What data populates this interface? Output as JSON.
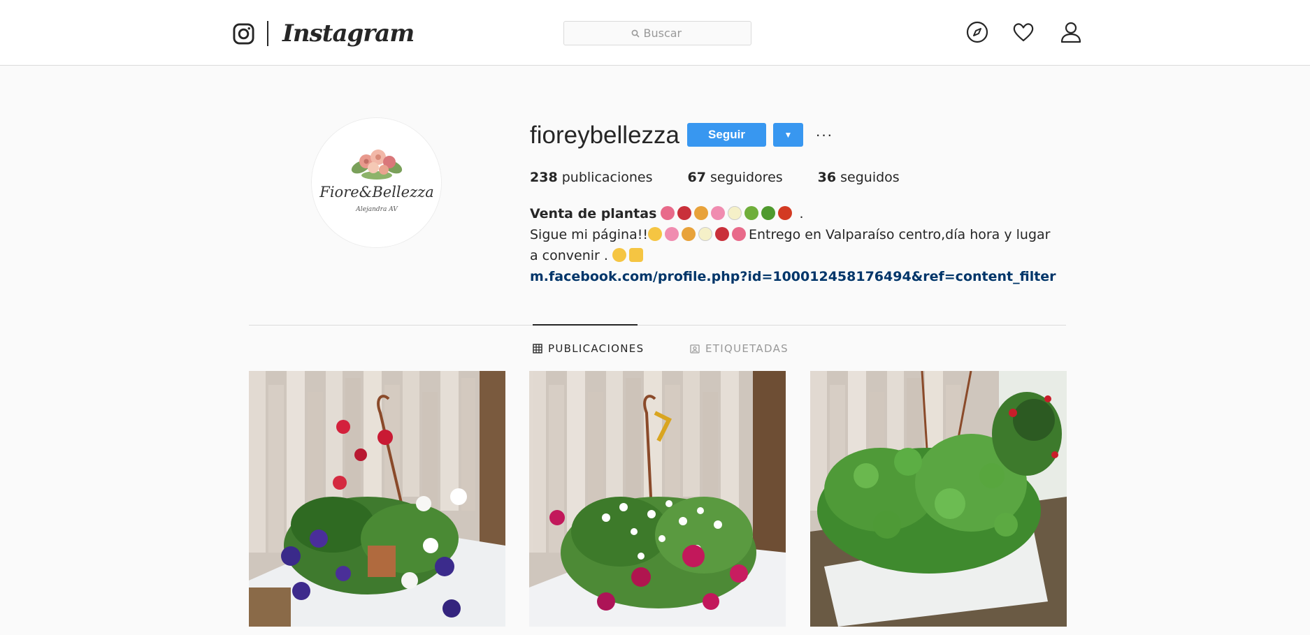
{
  "header": {
    "wordmark": "Instagram",
    "search_placeholder": "Buscar"
  },
  "profile": {
    "username": "fioreybellezza",
    "follow_label": "Seguir",
    "dropdown_glyph": "▼",
    "more_glyph": "···",
    "avatar_text": "Fiore&Bellezza",
    "avatar_subtext": "Alejandra AV",
    "stats": {
      "posts_count": "238",
      "posts_label": "publicaciones",
      "followers_count": "67",
      "followers_label": "seguidores",
      "following_count": "36",
      "following_label": "seguidos"
    },
    "bio": {
      "name": "Venta de plantas",
      "line1_end": ".",
      "line2_start": "Sigue mi página!!",
      "line2_end": "Entrego en Valparaíso centro,día hora y lugar a convenir .",
      "link": "m.facebook.com/profile.php?id=100012458176494&ref=content_filter"
    }
  },
  "tabs": [
    {
      "label": "PUBLICACIONES",
      "active": true
    },
    {
      "label": "ETIQUETADAS",
      "active": false
    }
  ],
  "colors": {
    "accent": "#3897f0",
    "link": "#003569",
    "border": "#dbdbdb",
    "background": "#fafafa"
  },
  "icons": {
    "logo": "instagram-camera-icon",
    "explore": "compass-icon",
    "activity": "heart-icon",
    "profile": "user-icon",
    "search": "search-icon",
    "grid": "grid-icon",
    "tagged": "tagged-portrait-icon"
  }
}
